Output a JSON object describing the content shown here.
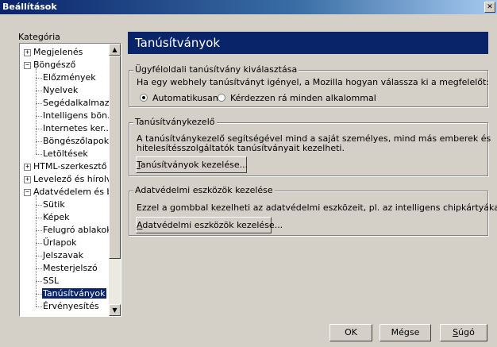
{
  "window": {
    "title": "Beállítások",
    "close_glyph": "✕"
  },
  "category": {
    "label": "Kategória"
  },
  "tree": [
    {
      "label": "Megjelenés",
      "expander": "+"
    },
    {
      "label": "Böngésző",
      "expander": "−"
    },
    {
      "label": "Előzmények"
    },
    {
      "label": "Nyelvek"
    },
    {
      "label": "Segédalkalmaz..."
    },
    {
      "label": "Intelligens bön..."
    },
    {
      "label": "Internetes ker..."
    },
    {
      "label": "Böngészőlapok"
    },
    {
      "label": "Letöltések"
    },
    {
      "label": "HTML-szerkesztő",
      "expander": "+"
    },
    {
      "label": "Levelező és hírolv...",
      "expander": "+"
    },
    {
      "label": "Adatvédelem és bi...",
      "expander": "−"
    },
    {
      "label": "Sütik"
    },
    {
      "label": "Képek"
    },
    {
      "label": "Felugró ablakok"
    },
    {
      "label": "Űrlapok"
    },
    {
      "label": "Jelszavak"
    },
    {
      "label": "Mesterjelszó"
    },
    {
      "label": "SSL"
    },
    {
      "label": "Tanúsítványok",
      "selected": true
    },
    {
      "label": "Érvényesítés"
    }
  ],
  "header": {
    "title": "Tanúsítványok"
  },
  "client_cert": {
    "legend": "Ügyféloldali tanúsítvány kiválasztása",
    "description": "Ha egy webhely tanúsítványt igényel, a Mozilla hogyan válassza ki a megfelelőt:",
    "option_auto": "Automatikusan",
    "option_ask": "Kérdezzen rá minden alkalommal",
    "selected": "option_auto"
  },
  "cert_manager": {
    "legend": "Tanúsítványkezelő",
    "description_line1": "A tanúsítványkezelő segítségével mind a saját személyes, mind más emberek és",
    "description_line2": "hitelesítésszolgáltatók tanúsítványait kezelheti.",
    "button_accel": "T",
    "button_rest": "anúsítványok kezelése..."
  },
  "privacy_tools": {
    "legend": "Adatvédelmi eszközök kezelése",
    "description": "Ezzel a gombbal kezelheti az adatvédelmi eszközeit, pl. az intelligens chipkártyákat.",
    "button_accel": "A",
    "button_rest": "datvédelmi eszközök kezelése..."
  },
  "footer": {
    "ok_label": "OK",
    "cancel_label": "Mégse",
    "help_accel": "S",
    "help_rest": "úgó"
  }
}
